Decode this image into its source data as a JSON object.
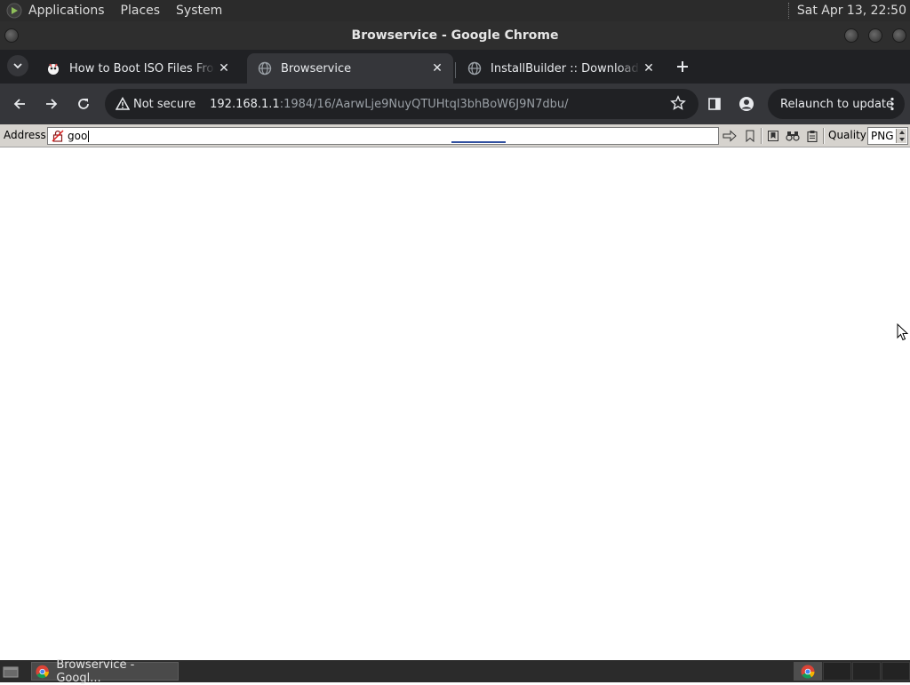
{
  "panel": {
    "menus": [
      "Applications",
      "Places",
      "System"
    ],
    "clock": "Sat Apr 13, 22:50"
  },
  "window": {
    "title": "Browservice - Google Chrome"
  },
  "tabs": [
    {
      "title": "How to Boot ISO Files From C",
      "favicon": "gnome-favicon",
      "active": false
    },
    {
      "title": "Browservice",
      "favicon": "globe-icon",
      "active": true
    },
    {
      "title": "InstallBuilder :: Download Ins",
      "favicon": "globe-icon",
      "active": false
    }
  ],
  "toolbar": {
    "security_label": "Not secure",
    "url_host": "192.168.1.1",
    "url_path": ":1984/16/AarwLje9NuyQTUHtql3bhBoW6J9N7dbu/",
    "relaunch_label": "Relaunch to update"
  },
  "browservice": {
    "address_label": "Address",
    "address_value": "goo",
    "quality_label": "Quality",
    "quality_value": "PNG"
  },
  "taskbar": {
    "task_title": "Browservice - Googl..."
  },
  "colors": {
    "panel_bg": "#2b2b2b",
    "tabstrip_bg": "#202124",
    "toolbar_bg": "#35363a",
    "browservice_bar_bg": "#d6d3ce"
  }
}
